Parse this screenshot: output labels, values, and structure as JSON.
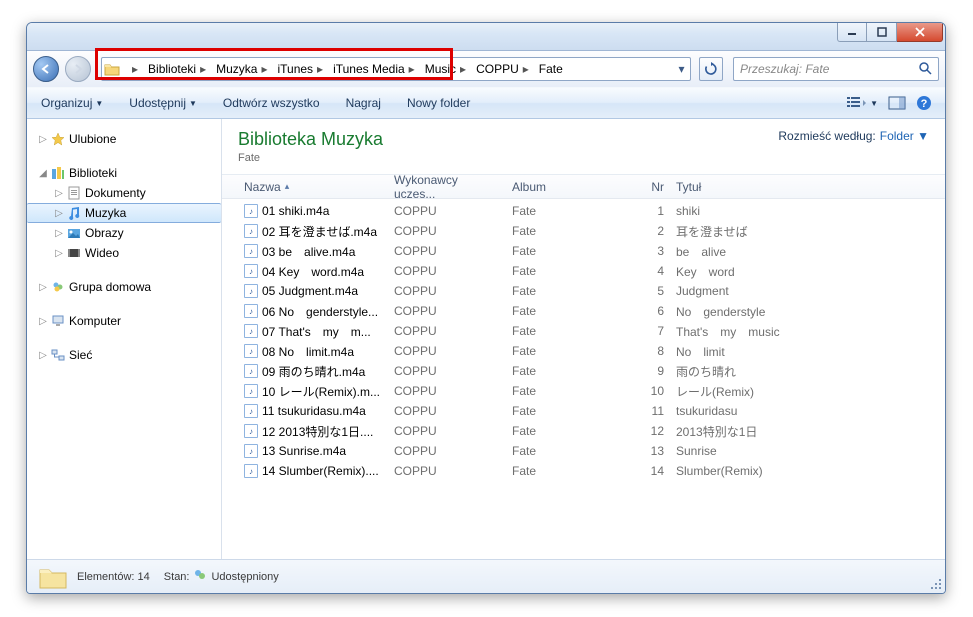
{
  "breadcrumb": [
    "Biblioteki",
    "Muzyka",
    "iTunes",
    "iTunes Media",
    "Music",
    "COPPU",
    "Fate"
  ],
  "search": {
    "placeholder": "Przeszukaj: Fate"
  },
  "toolbar": {
    "organize": "Organizuj",
    "share": "Udostępnij",
    "playall": "Odtwórz wszystko",
    "burn": "Nagraj",
    "newfolder": "Nowy folder"
  },
  "sidebar": {
    "favorites": "Ulubione",
    "libraries": "Biblioteki",
    "documents": "Dokumenty",
    "music": "Muzyka",
    "pictures": "Obrazy",
    "videos": "Wideo",
    "homegroup": "Grupa domowa",
    "computer": "Komputer",
    "network": "Sieć"
  },
  "library": {
    "title": "Biblioteka Muzyka",
    "subtitle": "Fate",
    "arrange_label": "Rozmieść według:",
    "arrange_value": "Folder"
  },
  "columns": {
    "name": "Nazwa",
    "artist": "Wykonawcy uczes...",
    "album": "Album",
    "nr": "Nr",
    "title": "Tytuł"
  },
  "files": [
    {
      "name": "01 shiki.m4a",
      "artist": "COPPU",
      "album": "Fate",
      "nr": "1",
      "title": "shiki"
    },
    {
      "name": "02 耳を澄ませば.m4a",
      "artist": "COPPU",
      "album": "Fate",
      "nr": "2",
      "title": "耳を澄ませば"
    },
    {
      "name": "03 be　alive.m4a",
      "artist": "COPPU",
      "album": "Fate",
      "nr": "3",
      "title": "be　alive"
    },
    {
      "name": "04 Key　word.m4a",
      "artist": "COPPU",
      "album": "Fate",
      "nr": "4",
      "title": "Key　word"
    },
    {
      "name": "05 Judgment.m4a",
      "artist": "COPPU",
      "album": "Fate",
      "nr": "5",
      "title": "Judgment"
    },
    {
      "name": "06 No　genderstyle...",
      "artist": "COPPU",
      "album": "Fate",
      "nr": "6",
      "title": "No　genderstyle"
    },
    {
      "name": "07 That's　my　m...",
      "artist": "COPPU",
      "album": "Fate",
      "nr": "7",
      "title": "That's　my　music"
    },
    {
      "name": "08 No　limit.m4a",
      "artist": "COPPU",
      "album": "Fate",
      "nr": "8",
      "title": "No　limit"
    },
    {
      "name": "09 雨のち晴れ.m4a",
      "artist": "COPPU",
      "album": "Fate",
      "nr": "9",
      "title": "雨のち晴れ"
    },
    {
      "name": "10 レール(Remix).m...",
      "artist": "COPPU",
      "album": "Fate",
      "nr": "10",
      "title": "レール(Remix)"
    },
    {
      "name": "11 tsukuridasu.m4a",
      "artist": "COPPU",
      "album": "Fate",
      "nr": "11",
      "title": "tsukuridasu"
    },
    {
      "name": "12 2013特別な1日....",
      "artist": "COPPU",
      "album": "Fate",
      "nr": "12",
      "title": "2013特別な1日"
    },
    {
      "name": "13 Sunrise.m4a",
      "artist": "COPPU",
      "album": "Fate",
      "nr": "13",
      "title": "Sunrise"
    },
    {
      "name": "14 Slumber(Remix)....",
      "artist": "COPPU",
      "album": "Fate",
      "nr": "14",
      "title": "Slumber(Remix)"
    }
  ],
  "status": {
    "count_label": "Elementów:",
    "count": "14",
    "state_label": "Stan:",
    "state": "Udostępniony"
  }
}
